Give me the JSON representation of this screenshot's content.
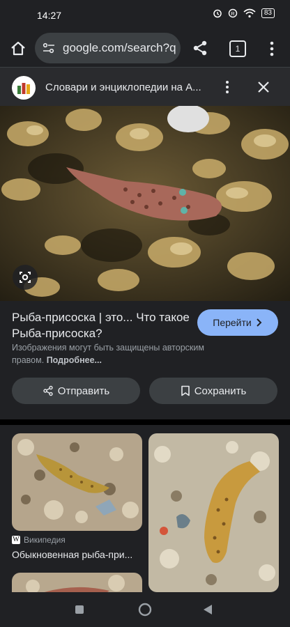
{
  "status_bar": {
    "time": "14:27",
    "battery": "83",
    "icons": [
      "alarm-icon",
      "registered-icon",
      "wifi-icon",
      "battery-icon"
    ]
  },
  "browser": {
    "url": "google.com/search?q",
    "tab_count": "1"
  },
  "panel": {
    "title": "Словари и энциклопедии на А..."
  },
  "result": {
    "title": "Рыба-присоска | это... Что такое Рыба-присоска?",
    "visit_label": "Перейти",
    "copyright_text": "Изображения могут быть защищены авторским правом.",
    "more_link": "Подробнее..."
  },
  "actions": {
    "share_label": "Отправить",
    "save_label": "Сохранить"
  },
  "related": [
    {
      "source": "Википедия",
      "title": "Обыкновенная рыба-при..."
    }
  ],
  "colors": {
    "background": "#202124",
    "accent": "#8ab4f8",
    "button": "#3c4043"
  }
}
